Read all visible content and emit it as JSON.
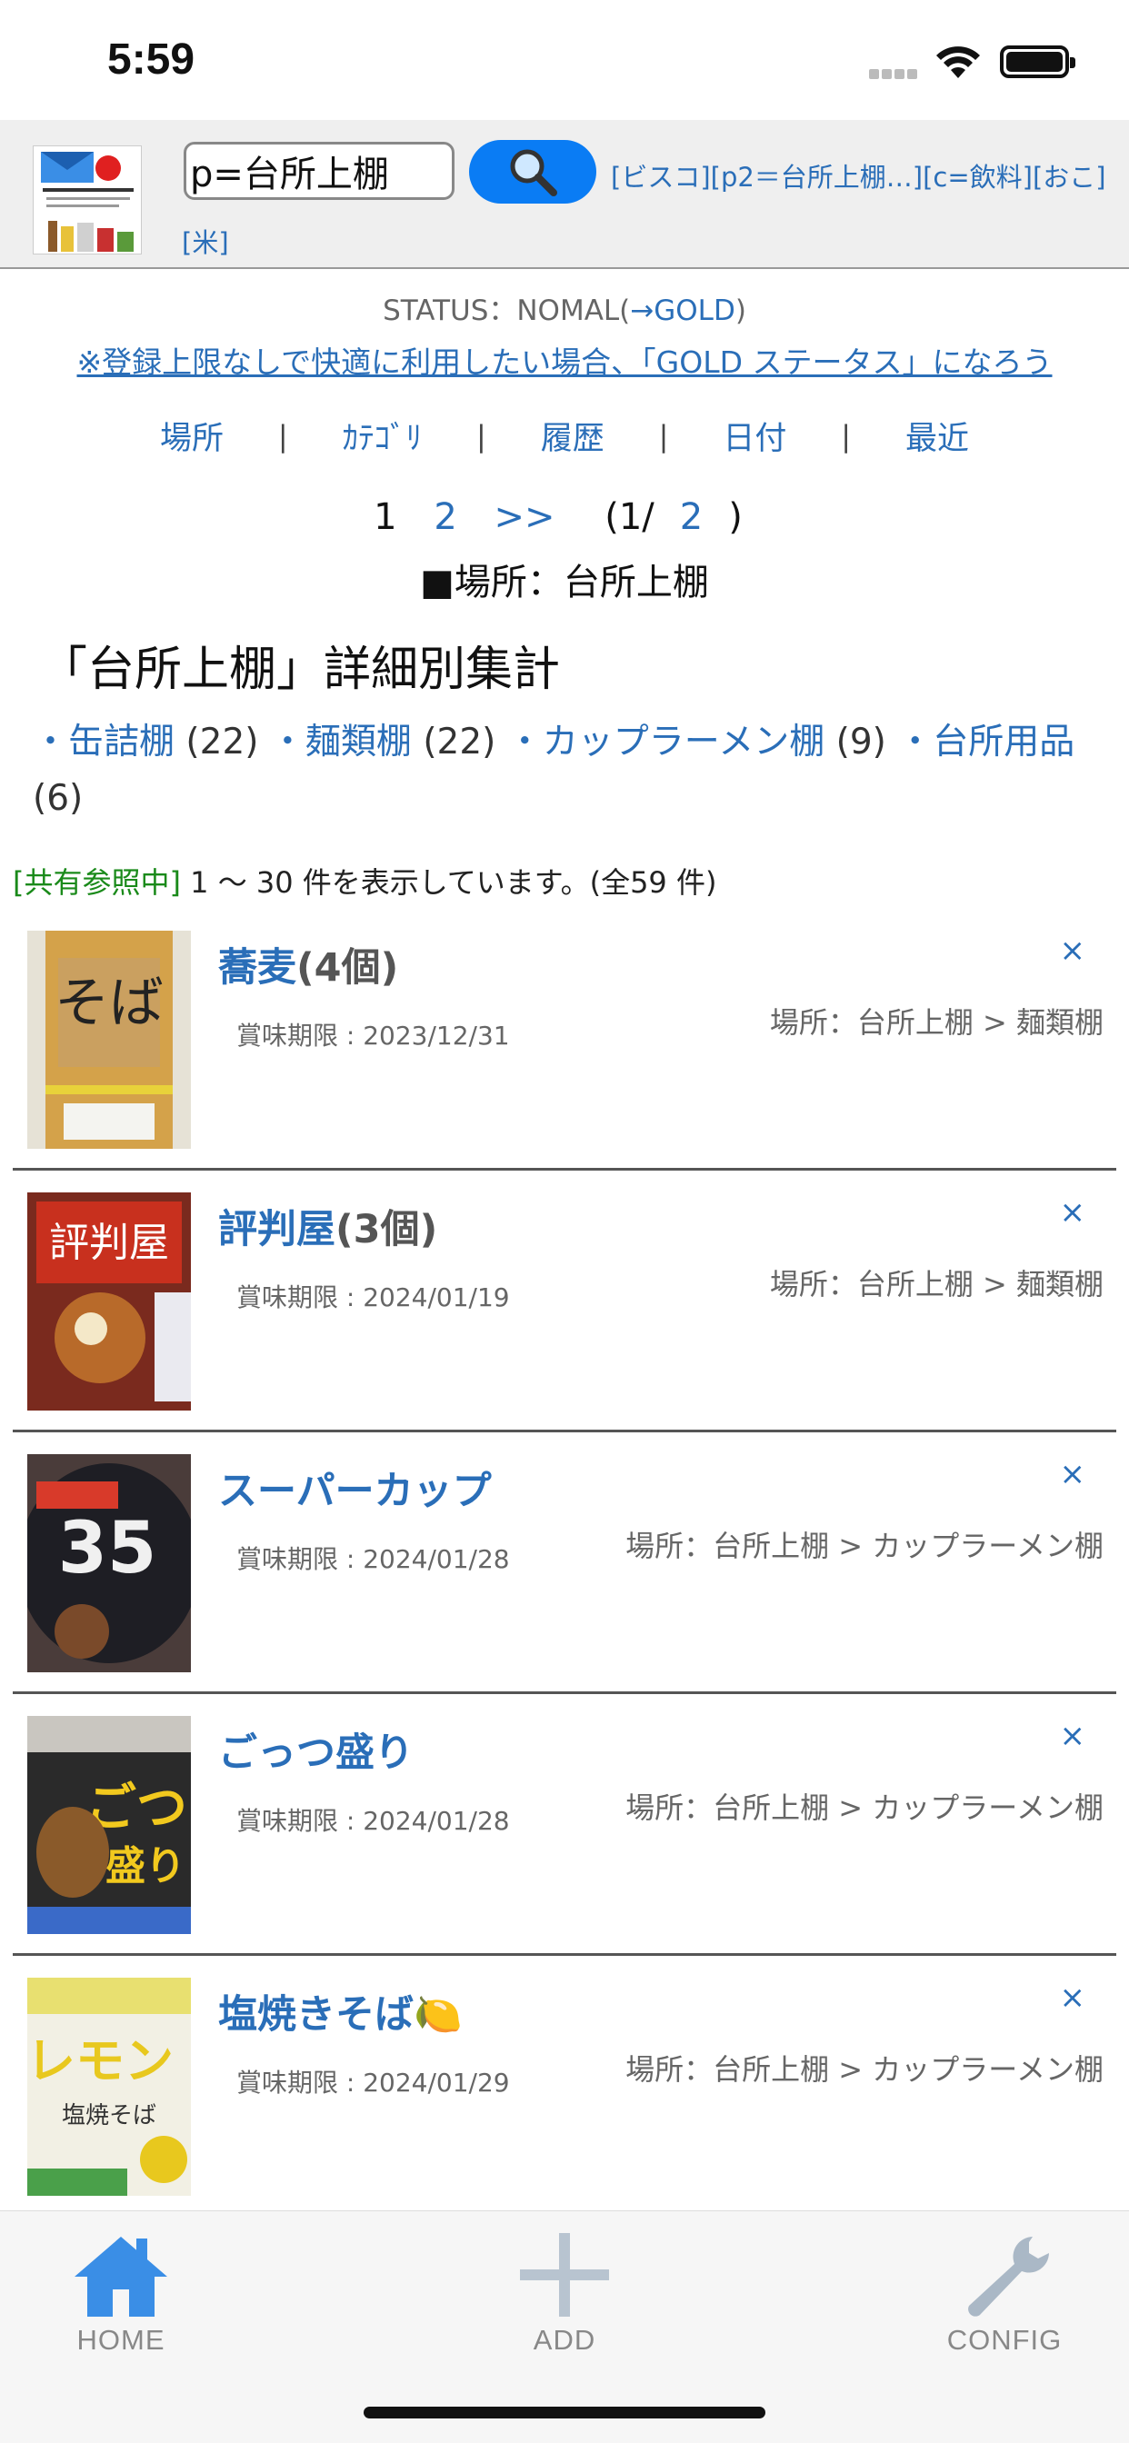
{
  "status_bar": {
    "time": "5:59"
  },
  "header": {
    "search_value": "p=台所上棚",
    "quick_links_line1": "[ビスコ][p2＝台所上棚…][c=飲料][おこ]",
    "quick_links_line2": "[米]"
  },
  "status": {
    "prefix": "STATUS：NOMAL(",
    "gold": "→GOLD",
    "suffix": ")"
  },
  "gold_message": "※登録上限なしで快適に利用したい場合、「GOLD ステータス」になろう",
  "nav": [
    "場所",
    "ｶﾃｺﾞﾘ",
    "履歴",
    "日付",
    "最近"
  ],
  "nav_separator": "|",
  "pager": {
    "current": "1",
    "next_page": "2",
    "next": ">>",
    "info_open": "(1/",
    "info_total": "2",
    "info_close": ")"
  },
  "location_title": "■場所：台所上棚",
  "summary_title": "「台所上棚」詳細別集計",
  "categories": [
    {
      "name": "・缶詰棚",
      "count": "(22)"
    },
    {
      "name": "・麺類棚",
      "count": "(22)"
    },
    {
      "name": "・カップラーメン棚",
      "count": "(9)"
    },
    {
      "name": "・台所用品",
      "count": "(6)"
    }
  ],
  "count_line": {
    "shared": "[共有参照中]",
    "text": " 1 〜 30 件を表示しています。(全59 件)"
  },
  "items": [
    {
      "name": "蕎麦",
      "qty": "(4個)",
      "expiry": "賞味期限 : 2023/12/31",
      "place": "場所：台所上棚 > 麺類棚",
      "close": "×"
    },
    {
      "name": "評判屋",
      "qty": "(3個)",
      "expiry": "賞味期限 : 2024/01/19",
      "place": "場所：台所上棚 > 麺類棚",
      "close": "×"
    },
    {
      "name": "スーパーカップ",
      "qty": "",
      "expiry": "賞味期限 : 2024/01/28",
      "place": "場所：台所上棚 > カップラーメン棚",
      "close": "×"
    },
    {
      "name": "ごっつ盛り",
      "qty": "",
      "expiry": "賞味期限 : 2024/01/28",
      "place": "場所：台所上棚 > カップラーメン棚",
      "close": "×"
    },
    {
      "name": "塩焼きそば🍋",
      "qty": "",
      "expiry": "賞味期限 : 2024/01/29",
      "place": "場所：台所上棚 > カップラーメン棚",
      "close": "×"
    }
  ],
  "tabs": [
    {
      "label": "HOME",
      "icon": "home-icon"
    },
    {
      "label": "ADD",
      "icon": "plus-icon"
    },
    {
      "label": "CONFIG",
      "icon": "wrench-icon"
    }
  ]
}
